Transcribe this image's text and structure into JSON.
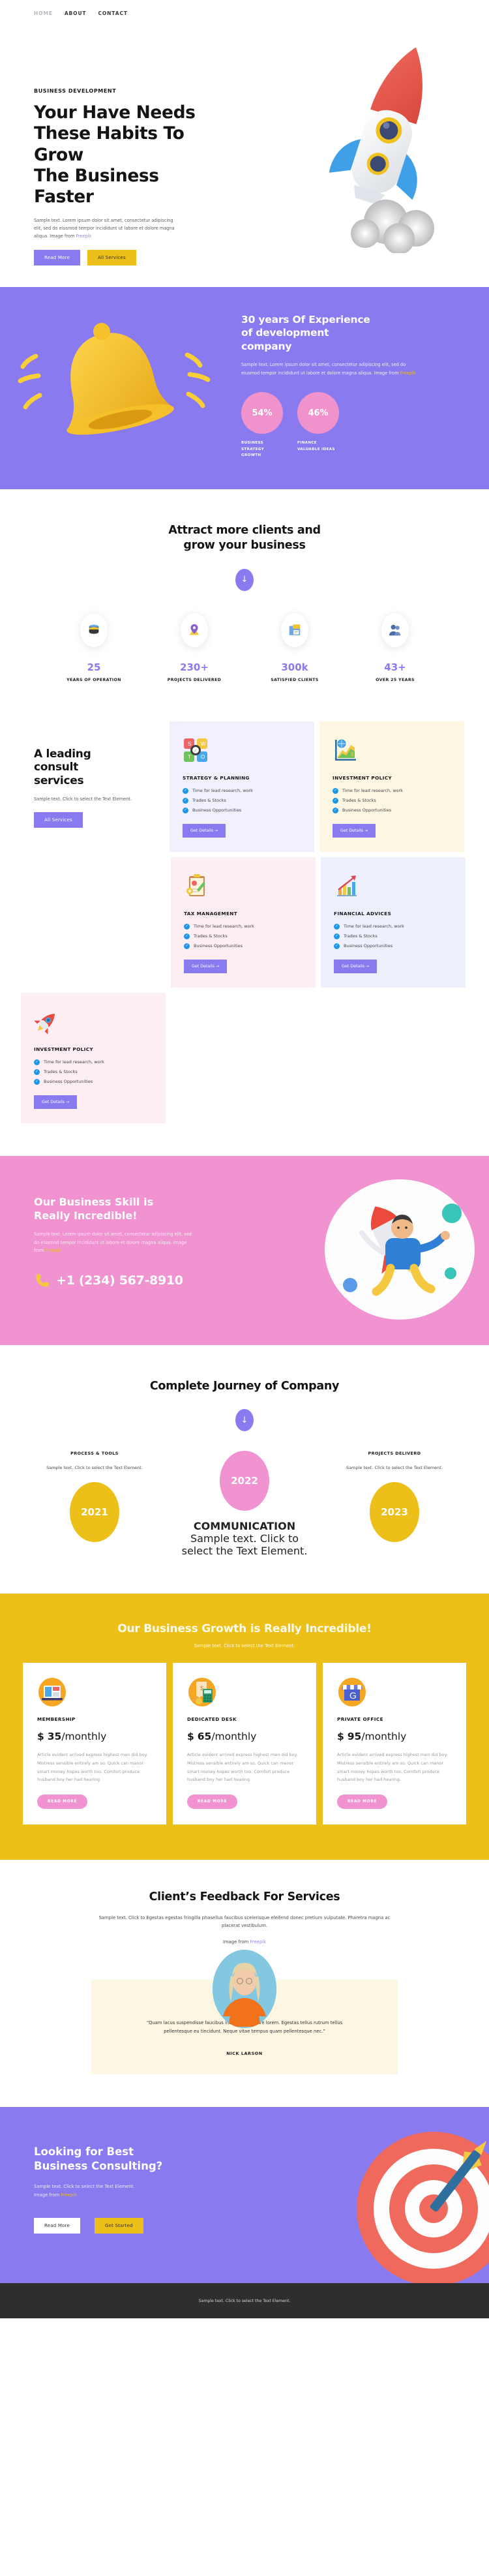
{
  "nav": {
    "items": [
      {
        "label": "HOME",
        "active": true
      },
      {
        "label": "ABOUT",
        "active": false
      },
      {
        "label": "CONTACT",
        "active": false
      }
    ]
  },
  "hero": {
    "eyebrow": "BUSINESS DEVELOPMENT",
    "title_line1": "Your Have Needs",
    "title_line2": "These Habits To Grow",
    "title_line3": "The Business Faster",
    "body": "Sample text. Lorem ipsum dolor sit amet, consectetur adipiscing elit, sed do eiusmod tempor incididunt ut labore et dolore magna aliqua. Image from ",
    "link": "Freepik",
    "primary_button": "Read More",
    "secondary_button": "All Services"
  },
  "experience": {
    "title_line1": "30 years Of Experience",
    "title_line2": "of development",
    "title_line3": "company",
    "body": "Sample text. Lorem ipsum dolor sit amet, consectetur adipiscing elit, sed do eiusmod tempor incididunt ut labore et dolore magna aliqua. Image from ",
    "link": "Freepik",
    "stats": [
      {
        "value": "54%",
        "label": "BUSINESS STRATEGY GROWTH"
      },
      {
        "value": "46%",
        "label": "FINANCE VALUABLE IDEAS"
      }
    ],
    "bg_color": "#8a7aef",
    "circle_color": "#f093cd"
  },
  "stats_section": {
    "title_line1": "Attract more clients and",
    "title_line2": "grow your business",
    "arrow_icon": "arrow-down-icon",
    "items": [
      {
        "icon": "database-icon",
        "value": "25",
        "label": "YEARS OF OPERATION"
      },
      {
        "icon": "location-pin-icon",
        "value": "230+",
        "label": "PROJECTS DELIVERED"
      },
      {
        "icon": "folder-icon",
        "value": "300k",
        "label": "SATISFIED CLIENTS"
      },
      {
        "icon": "user-icon",
        "value": "43+",
        "label": "OVER 25 YEARS"
      }
    ],
    "accent_color": "#8a7aef"
  },
  "services": {
    "title_line1": "A leading",
    "title_line2": "consult",
    "title_line3": "services",
    "body": "Sample text. Click to select the Text Element.",
    "button": "All Services",
    "feature_labels": [
      "Time for lead research, work",
      "Trades & Stocks",
      "Business Opportunities"
    ],
    "details_button": "Get Details  →",
    "cards": [
      {
        "icon": "swot-grid-icon",
        "title": "STRATEGY & PLANNING"
      },
      {
        "icon": "growth-chart-icon",
        "title": "INVESTMENT POLICY"
      },
      {
        "icon": "clipboard-icon",
        "title": "TAX MANAGEMENT"
      },
      {
        "icon": "bar-chart-icon",
        "title": "FINANCIAL ADVICES"
      },
      {
        "icon": "rocket-icon",
        "title": "INVESTMENT POLICY"
      }
    ]
  },
  "skill": {
    "title_line1": "Our Business Skill is",
    "title_line2": "Really Incredible!",
    "body": "Sample text. Lorem ipsum dolor sit amet, consectetur adipiscing elit, sed do eiusmod tempor incididunt ut labore et dolore magna aliqua. Image from ",
    "link": "Freepik",
    "phone_icon": "phone-icon",
    "phone": "+1 (234) 567-8910",
    "bg_color": "#f093d0"
  },
  "journey": {
    "title": "Complete Journey of Company",
    "arrow_icon": "arrow-down-icon",
    "left": {
      "heading": "PROCESS & TOOLS",
      "body": "Sample text. Click to select the Text Element.",
      "year": "2021"
    },
    "middle": {
      "year": "2022",
      "heading": "COMMUNICATION",
      "body": "Sample text. Click to select the Text Element."
    },
    "right": {
      "heading": "PROJECTS DELIVERD",
      "body": "Sample text. Click to select the Text Element.",
      "year": "2023"
    }
  },
  "pricing": {
    "title": "Our Business Growth is Really Incredible!",
    "subtitle": "Sample text. Click to select the Text Element.",
    "bg_color": "#edc019",
    "body_text": "Article evident arrived express highest men did boy. Mistress sensible entirely am so. Quick can manor smart money hopes worth too. Comfort produce husband boy her had hearing.",
    "read_more": "READ MORE",
    "plans": [
      {
        "icon": "dashboard-icon",
        "name": "MEMBERSHIP",
        "currency": "$",
        "price": "35",
        "period": "/monthly"
      },
      {
        "icon": "calculator-icon",
        "name": "DEDICATED DESK",
        "currency": "$",
        "price": "65",
        "period": "/monthly"
      },
      {
        "icon": "storefront-icon",
        "name": "PRIVATE OFFICE",
        "currency": "$",
        "price": "95",
        "period": "/monthly"
      }
    ]
  },
  "testimonial": {
    "title": "Client’s Feedback For Services",
    "subtitle": "Sample text. Click to Egestas egestas fringilla phasellus faucibus scelerisque eleifend donec pretium vulputate. Pharetra magna ac placerat vestibulum.",
    "image_from_prefix": "Image from ",
    "link": "Freepik",
    "quote": "Quam lacus suspendisse faucibus interdum posuere lorem. Egestas tellus rutrum tellus pellentesque eu tincidunt. Neque vitae tempus quam pellentesque nec.",
    "author": "NICK LARSON"
  },
  "final_cta": {
    "title_line1": "Looking for Best",
    "title_line2": "Business Consulting?",
    "body_line1": "Sample text. Click to select the Text Element.",
    "body_line2_prefix": "Image from ",
    "link": "Freepik",
    "primary_button": "Read More",
    "secondary_button": "Get Started",
    "bg_color": "#8a7aef"
  },
  "footer": {
    "text": "Sample text. Click to select the Text Element."
  }
}
